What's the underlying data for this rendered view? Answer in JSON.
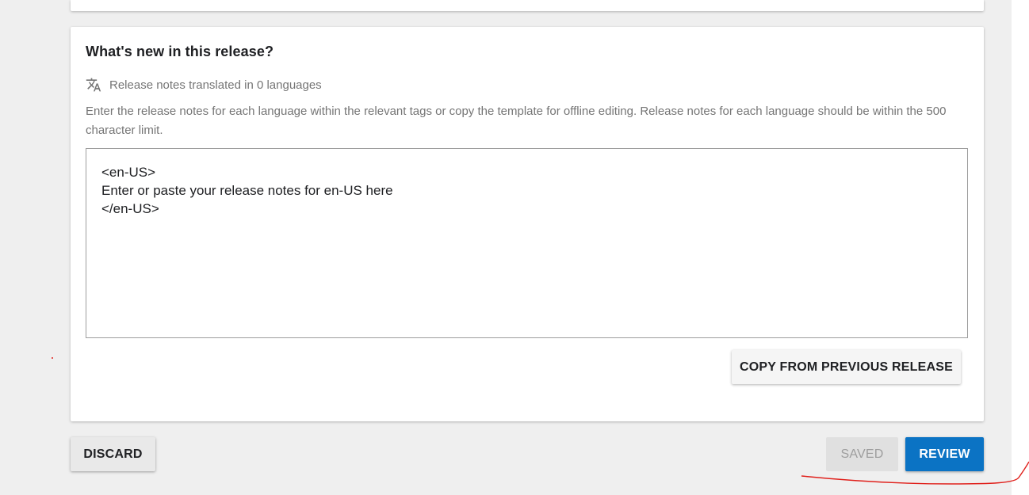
{
  "section": {
    "title": "What's new in this release?",
    "translation_status": "Release notes translated in 0 languages",
    "instructions": "Enter the release notes for each language within the relevant tags or copy the template for offline editing. Release notes for each language should be within the 500 character limit.",
    "release_notes_value": "<en-US>\nEnter or paste your release notes for en-US here\n</en-US>",
    "copy_button_label": "COPY FROM PREVIOUS RELEASE"
  },
  "footer": {
    "discard_label": "DISCARD",
    "saved_label": "SAVED",
    "review_label": "REVIEW"
  },
  "icons": {
    "translate": "translate-icon"
  },
  "colors": {
    "primary": "#0b73c4",
    "annotation": "#e0201b",
    "muted_text": "#757575"
  }
}
